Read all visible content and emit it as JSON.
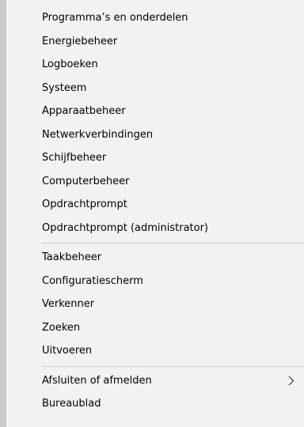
{
  "menu": {
    "group1": [
      "Programma’s en onderdelen",
      "Energiebeheer",
      "Logboeken",
      "Systeem",
      "Apparaatbeheer",
      "Netwerkverbindingen",
      "Schijfbeheer",
      "Computerbeheer",
      "Opdrachtprompt",
      "Opdrachtprompt (administrator)"
    ],
    "group2": [
      "Taakbeheer",
      "Configuratiescherm",
      "Verkenner",
      "Zoeken",
      "Uitvoeren"
    ],
    "group3": [
      "Afsluiten of afmelden",
      "Bureaublad"
    ]
  },
  "icons": {
    "submenu_arrow": "chevron-right-icon"
  }
}
